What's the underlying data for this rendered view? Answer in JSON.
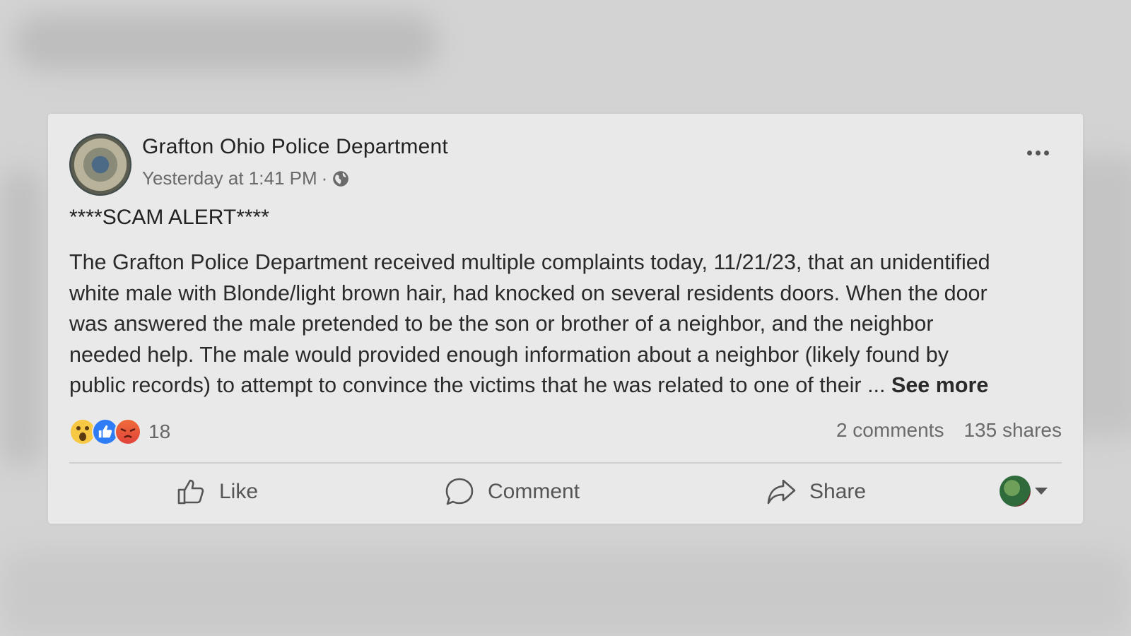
{
  "post": {
    "page_name": "Grafton Ohio Police Department",
    "timestamp": "Yesterday at 1:41 PM",
    "separator": "·",
    "privacy_icon": "globe-icon",
    "headline": "****SCAM ALERT****",
    "body": "The Grafton Police Department received multiple complaints today, 11/21/23, that an unidentified\nwhite male with Blonde/light brown hair, had knocked on several residents doors.  When the door\nwas answered the male pretended to be the son or brother of a neighbor, and the neighbor\nneeded help.  The male would provided enough information about a neighbor (likely found by\npublic records) to attempt to convince the victims that he was related to one of their ",
    "ellipsis": "...",
    "see_more_label": "See more"
  },
  "engagement": {
    "reaction_icons": [
      "wow-icon",
      "like-icon",
      "angry-icon"
    ],
    "reaction_count": "18",
    "comments": "2 comments",
    "shares": "135 shares"
  },
  "actions": {
    "like_label": "Like",
    "comment_label": "Comment",
    "share_label": "Share"
  },
  "colors": {
    "like_blue": "#2e7cf6",
    "wow_yellow": "#f7c843",
    "angry_red": "#e0443a"
  }
}
